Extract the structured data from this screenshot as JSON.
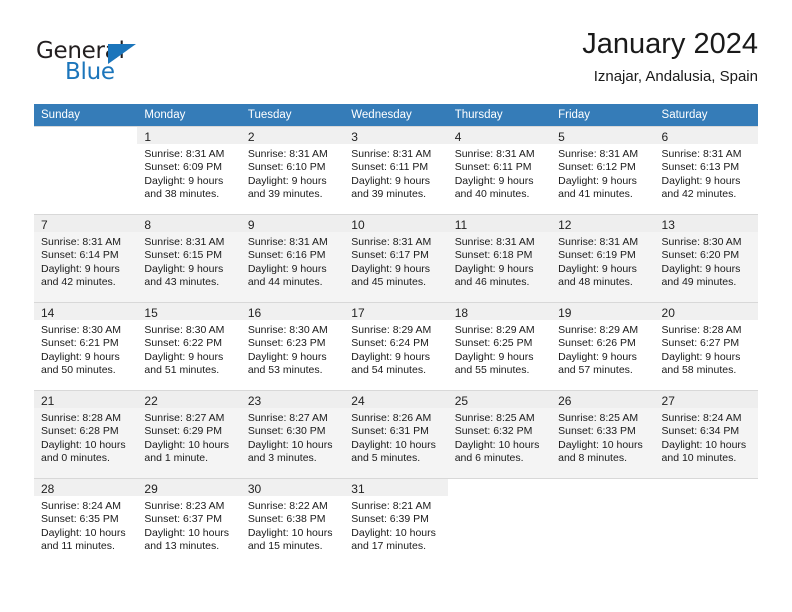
{
  "brand": {
    "word_one": "General",
    "word_two": "Blue",
    "accent_color": "#1b75bb",
    "triangle_icon": "triangle-icon"
  },
  "header": {
    "title": "January 2024",
    "location": "Iznajar, Andalusia, Spain"
  },
  "calendar": {
    "header_bg": "#357cb8",
    "weekday_headers": [
      "Sunday",
      "Monday",
      "Tuesday",
      "Wednesday",
      "Thursday",
      "Friday",
      "Saturday"
    ],
    "weeks": [
      [
        {
          "day": "",
          "lines": []
        },
        {
          "day": "1",
          "lines": [
            "Sunrise: 8:31 AM",
            "Sunset: 6:09 PM",
            "Daylight: 9 hours",
            "and 38 minutes."
          ]
        },
        {
          "day": "2",
          "lines": [
            "Sunrise: 8:31 AM",
            "Sunset: 6:10 PM",
            "Daylight: 9 hours",
            "and 39 minutes."
          ]
        },
        {
          "day": "3",
          "lines": [
            "Sunrise: 8:31 AM",
            "Sunset: 6:11 PM",
            "Daylight: 9 hours",
            "and 39 minutes."
          ]
        },
        {
          "day": "4",
          "lines": [
            "Sunrise: 8:31 AM",
            "Sunset: 6:11 PM",
            "Daylight: 9 hours",
            "and 40 minutes."
          ]
        },
        {
          "day": "5",
          "lines": [
            "Sunrise: 8:31 AM",
            "Sunset: 6:12 PM",
            "Daylight: 9 hours",
            "and 41 minutes."
          ]
        },
        {
          "day": "6",
          "lines": [
            "Sunrise: 8:31 AM",
            "Sunset: 6:13 PM",
            "Daylight: 9 hours",
            "and 42 minutes."
          ]
        }
      ],
      [
        {
          "day": "7",
          "lines": [
            "Sunrise: 8:31 AM",
            "Sunset: 6:14 PM",
            "Daylight: 9 hours",
            "and 42 minutes."
          ]
        },
        {
          "day": "8",
          "lines": [
            "Sunrise: 8:31 AM",
            "Sunset: 6:15 PM",
            "Daylight: 9 hours",
            "and 43 minutes."
          ]
        },
        {
          "day": "9",
          "lines": [
            "Sunrise: 8:31 AM",
            "Sunset: 6:16 PM",
            "Daylight: 9 hours",
            "and 44 minutes."
          ]
        },
        {
          "day": "10",
          "lines": [
            "Sunrise: 8:31 AM",
            "Sunset: 6:17 PM",
            "Daylight: 9 hours",
            "and 45 minutes."
          ]
        },
        {
          "day": "11",
          "lines": [
            "Sunrise: 8:31 AM",
            "Sunset: 6:18 PM",
            "Daylight: 9 hours",
            "and 46 minutes."
          ]
        },
        {
          "day": "12",
          "lines": [
            "Sunrise: 8:31 AM",
            "Sunset: 6:19 PM",
            "Daylight: 9 hours",
            "and 48 minutes."
          ]
        },
        {
          "day": "13",
          "lines": [
            "Sunrise: 8:30 AM",
            "Sunset: 6:20 PM",
            "Daylight: 9 hours",
            "and 49 minutes."
          ]
        }
      ],
      [
        {
          "day": "14",
          "lines": [
            "Sunrise: 8:30 AM",
            "Sunset: 6:21 PM",
            "Daylight: 9 hours",
            "and 50 minutes."
          ]
        },
        {
          "day": "15",
          "lines": [
            "Sunrise: 8:30 AM",
            "Sunset: 6:22 PM",
            "Daylight: 9 hours",
            "and 51 minutes."
          ]
        },
        {
          "day": "16",
          "lines": [
            "Sunrise: 8:30 AM",
            "Sunset: 6:23 PM",
            "Daylight: 9 hours",
            "and 53 minutes."
          ]
        },
        {
          "day": "17",
          "lines": [
            "Sunrise: 8:29 AM",
            "Sunset: 6:24 PM",
            "Daylight: 9 hours",
            "and 54 minutes."
          ]
        },
        {
          "day": "18",
          "lines": [
            "Sunrise: 8:29 AM",
            "Sunset: 6:25 PM",
            "Daylight: 9 hours",
            "and 55 minutes."
          ]
        },
        {
          "day": "19",
          "lines": [
            "Sunrise: 8:29 AM",
            "Sunset: 6:26 PM",
            "Daylight: 9 hours",
            "and 57 minutes."
          ]
        },
        {
          "day": "20",
          "lines": [
            "Sunrise: 8:28 AM",
            "Sunset: 6:27 PM",
            "Daylight: 9 hours",
            "and 58 minutes."
          ]
        }
      ],
      [
        {
          "day": "21",
          "lines": [
            "Sunrise: 8:28 AM",
            "Sunset: 6:28 PM",
            "Daylight: 10 hours",
            "and 0 minutes."
          ]
        },
        {
          "day": "22",
          "lines": [
            "Sunrise: 8:27 AM",
            "Sunset: 6:29 PM",
            "Daylight: 10 hours",
            "and 1 minute."
          ]
        },
        {
          "day": "23",
          "lines": [
            "Sunrise: 8:27 AM",
            "Sunset: 6:30 PM",
            "Daylight: 10 hours",
            "and 3 minutes."
          ]
        },
        {
          "day": "24",
          "lines": [
            "Sunrise: 8:26 AM",
            "Sunset: 6:31 PM",
            "Daylight: 10 hours",
            "and 5 minutes."
          ]
        },
        {
          "day": "25",
          "lines": [
            "Sunrise: 8:25 AM",
            "Sunset: 6:32 PM",
            "Daylight: 10 hours",
            "and 6 minutes."
          ]
        },
        {
          "day": "26",
          "lines": [
            "Sunrise: 8:25 AM",
            "Sunset: 6:33 PM",
            "Daylight: 10 hours",
            "and 8 minutes."
          ]
        },
        {
          "day": "27",
          "lines": [
            "Sunrise: 8:24 AM",
            "Sunset: 6:34 PM",
            "Daylight: 10 hours",
            "and 10 minutes."
          ]
        }
      ],
      [
        {
          "day": "28",
          "lines": [
            "Sunrise: 8:24 AM",
            "Sunset: 6:35 PM",
            "Daylight: 10 hours",
            "and 11 minutes."
          ]
        },
        {
          "day": "29",
          "lines": [
            "Sunrise: 8:23 AM",
            "Sunset: 6:37 PM",
            "Daylight: 10 hours",
            "and 13 minutes."
          ]
        },
        {
          "day": "30",
          "lines": [
            "Sunrise: 8:22 AM",
            "Sunset: 6:38 PM",
            "Daylight: 10 hours",
            "and 15 minutes."
          ]
        },
        {
          "day": "31",
          "lines": [
            "Sunrise: 8:21 AM",
            "Sunset: 6:39 PM",
            "Daylight: 10 hours",
            "and 17 minutes."
          ]
        },
        {
          "day": "",
          "lines": []
        },
        {
          "day": "",
          "lines": []
        },
        {
          "day": "",
          "lines": []
        }
      ]
    ]
  }
}
